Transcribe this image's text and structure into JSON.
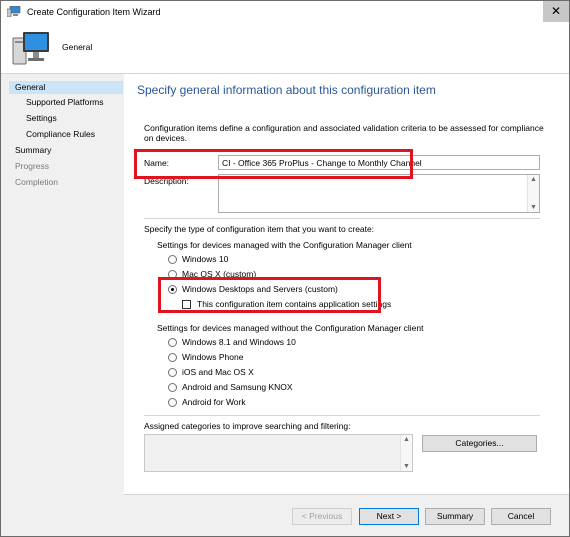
{
  "window": {
    "title": "Create Configuration Item Wizard",
    "close_glyph": "✕"
  },
  "header": {
    "title": "General"
  },
  "sidebar": {
    "items": [
      {
        "label": "General",
        "state": "active"
      },
      {
        "label": "Supported Platforms",
        "state": "normal"
      },
      {
        "label": "Settings",
        "state": "normal"
      },
      {
        "label": "Compliance Rules",
        "state": "normal"
      },
      {
        "label": "Summary",
        "state": "normal"
      },
      {
        "label": "Progress",
        "state": "disabled"
      },
      {
        "label": "Completion",
        "state": "disabled"
      }
    ]
  },
  "main": {
    "heading": "Specify general information about this configuration item",
    "description": "Configuration items define a configuration and associated validation criteria to be assessed for compliance on devices.",
    "name_label": "Name:",
    "name_value": "CI - Office 365 ProPlus - Change to Monthly Channel",
    "description_label": "Description:",
    "description_value": "",
    "type_prompt": "Specify the type of configuration item that you want to create:",
    "managed_group_label": "Settings for devices managed with the Configuration Manager client",
    "managed_options": [
      {
        "label": "Windows 10",
        "selected": false
      },
      {
        "label": "Mac OS X (custom)",
        "selected": false
      },
      {
        "label": "Windows Desktops and Servers (custom)",
        "selected": true
      }
    ],
    "app_settings_checkbox": {
      "label": "This configuration item contains application settings",
      "checked": false
    },
    "unmanaged_group_label": "Settings for devices managed without the Configuration Manager client",
    "unmanaged_options": [
      {
        "label": "Windows 8.1 and Windows 10",
        "selected": false
      },
      {
        "label": "Windows Phone",
        "selected": false
      },
      {
        "label": "iOS and Mac OS X",
        "selected": false
      },
      {
        "label": "Android and Samsung KNOX",
        "selected": false
      },
      {
        "label": "Android for Work",
        "selected": false
      }
    ],
    "categories_label": "Assigned categories to improve searching and filtering:",
    "categories_button": "Categories..."
  },
  "footer": {
    "previous": "< Previous",
    "next": "Next >",
    "summary": "Summary",
    "cancel": "Cancel"
  },
  "colors": {
    "accent_heading": "#2b579a",
    "highlight_box": "#e0141e",
    "active_nav": "#cde3f7"
  },
  "icons": {
    "title": "wizard-computer-icon",
    "header": "computer-monitor-icon"
  }
}
